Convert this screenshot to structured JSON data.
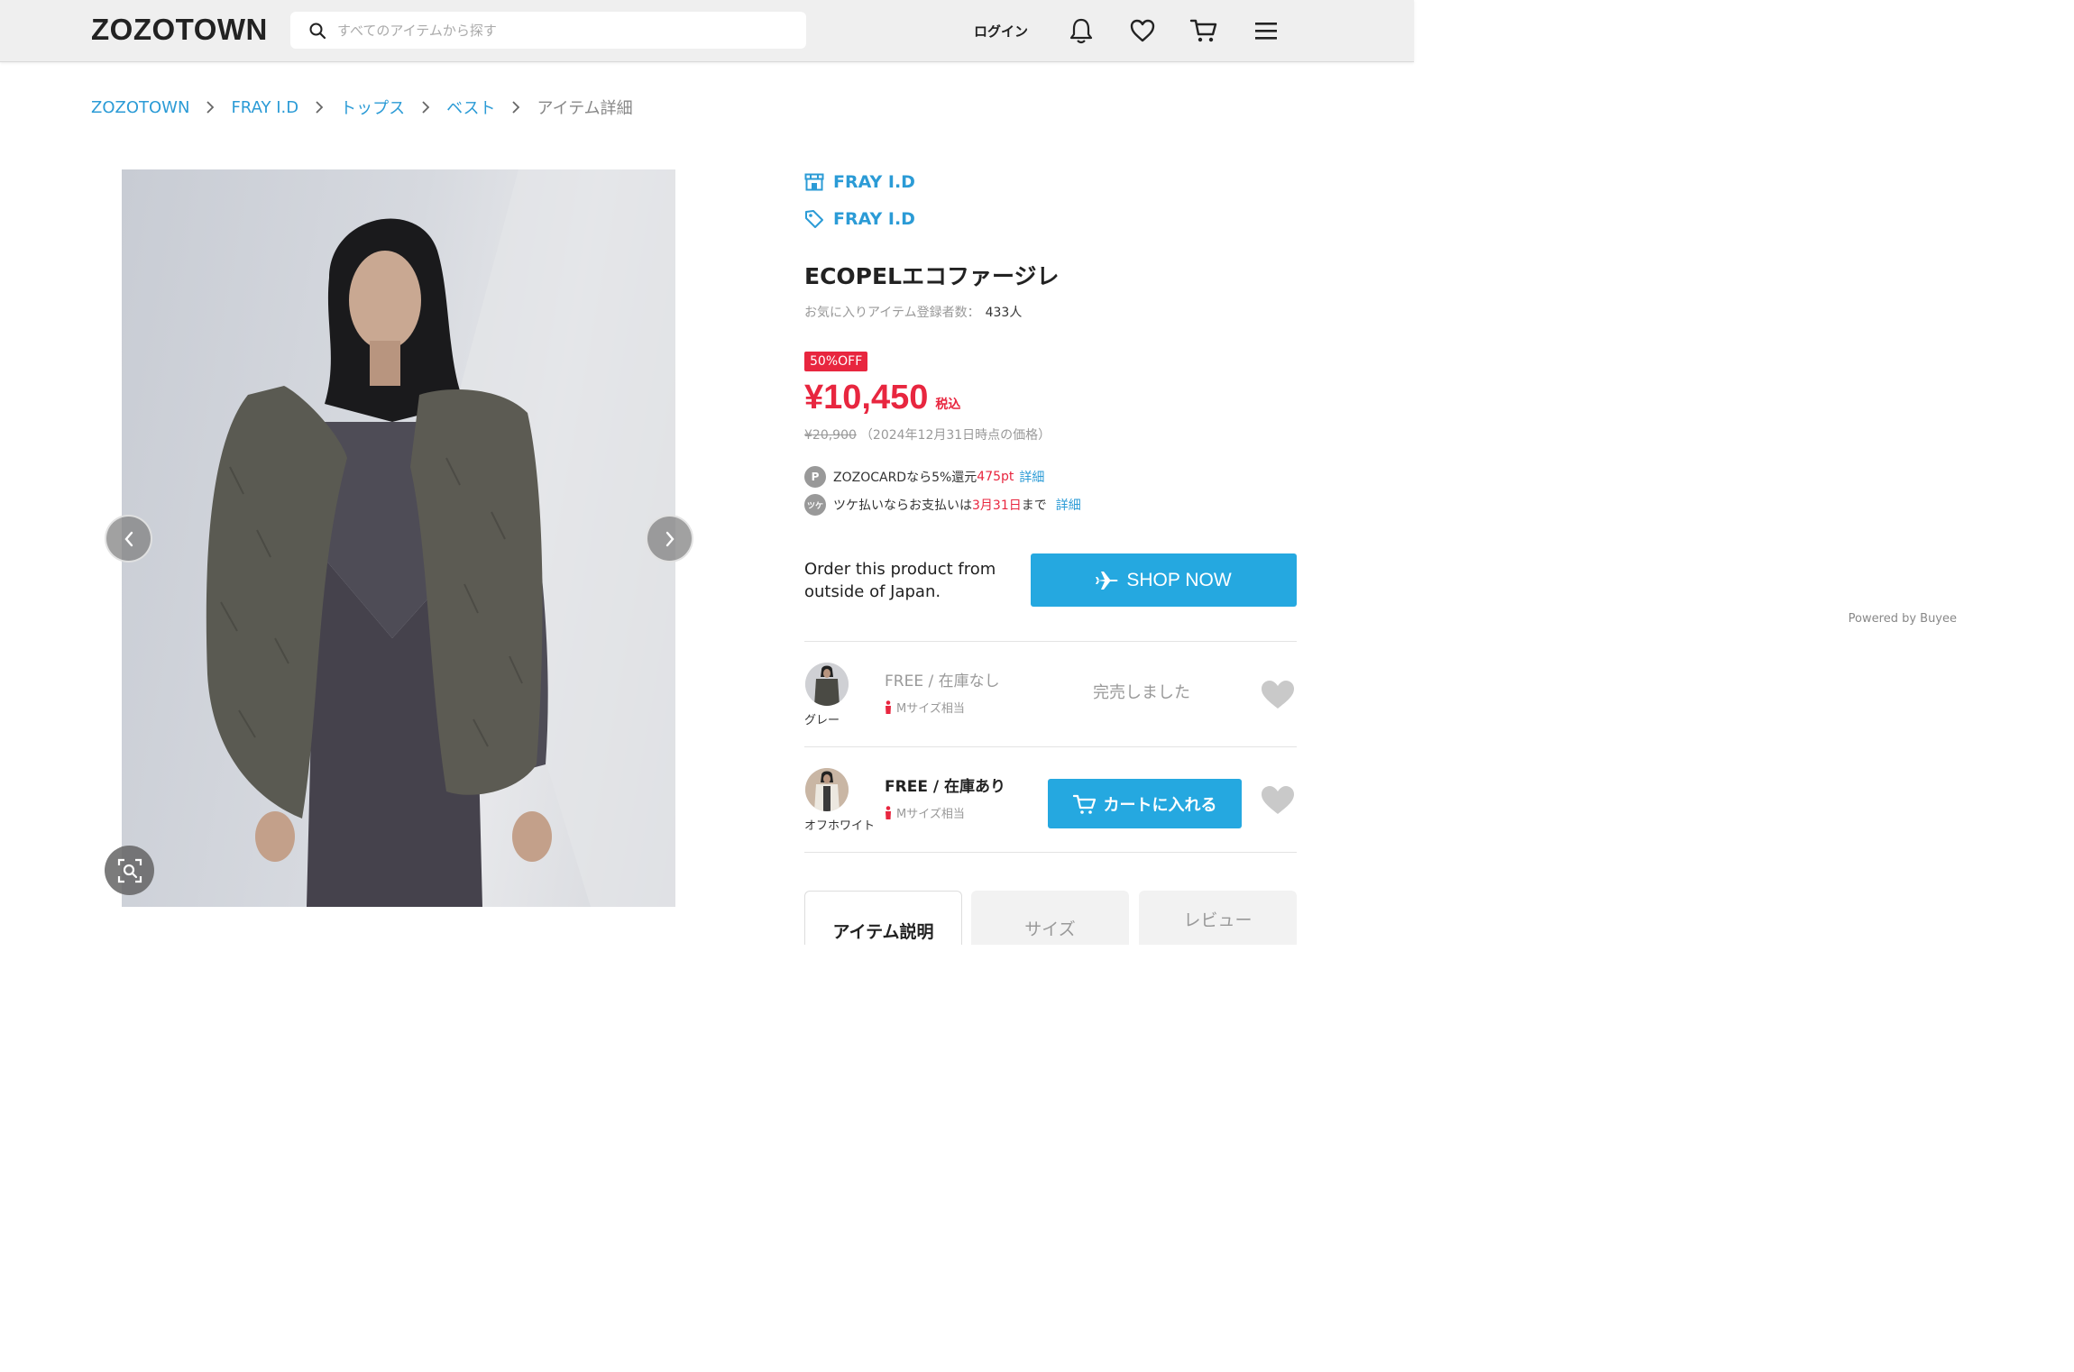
{
  "header": {
    "logo": "ZOZOTOWN",
    "search_placeholder": "すべてのアイテムから探す",
    "login_label": "ログイン"
  },
  "breadcrumb": {
    "items": [
      "ZOZOTOWN",
      "FRAY I.D",
      "トップス",
      "ベスト"
    ],
    "current": "アイテム詳細"
  },
  "product": {
    "shop_name": "FRAY I.D",
    "brand_name": "FRAY I.D",
    "title": "ECOPELエコファージレ",
    "favorite_label": "お気に入りアイテム登録者数：",
    "favorite_count": "433人",
    "discount_badge": "50%OFF",
    "price": "¥10,450",
    "price_tax": "税込",
    "original_price": "¥20,900",
    "original_price_note": "（2024年12月31日時点の価格）",
    "zozocard": {
      "icon_label": "P",
      "text_before": "ZOZOCARDなら5%還元",
      "points": "475pt",
      "link": "詳細"
    },
    "tsuke": {
      "icon_label": "ツケ",
      "text_before": "ツケ払いならお支払いは",
      "date": "3月31日",
      "text_after": "まで",
      "link": "詳細"
    }
  },
  "buyee": {
    "order_text": "Order this product from outside of Japan.",
    "button_label": "SHOP NOW",
    "powered_by": "Powered by Buyee"
  },
  "variants": [
    {
      "color": "グレー",
      "size_stock": "FREE / 在庫なし",
      "size_note": "Mサイズ相当",
      "status": "完売しました",
      "in_stock": false
    },
    {
      "color": "オフホワイト",
      "size_stock": "FREE / 在庫あり",
      "size_note": "Mサイズ相当",
      "cart_label": "カートに入れる",
      "in_stock": true
    }
  ],
  "tabs": [
    "アイテム説明",
    "サイズ",
    "レビュー"
  ],
  "colors": {
    "accent_blue": "#25a8e0",
    "link_blue": "#2b9bd6",
    "sale_red": "#e8263f"
  }
}
